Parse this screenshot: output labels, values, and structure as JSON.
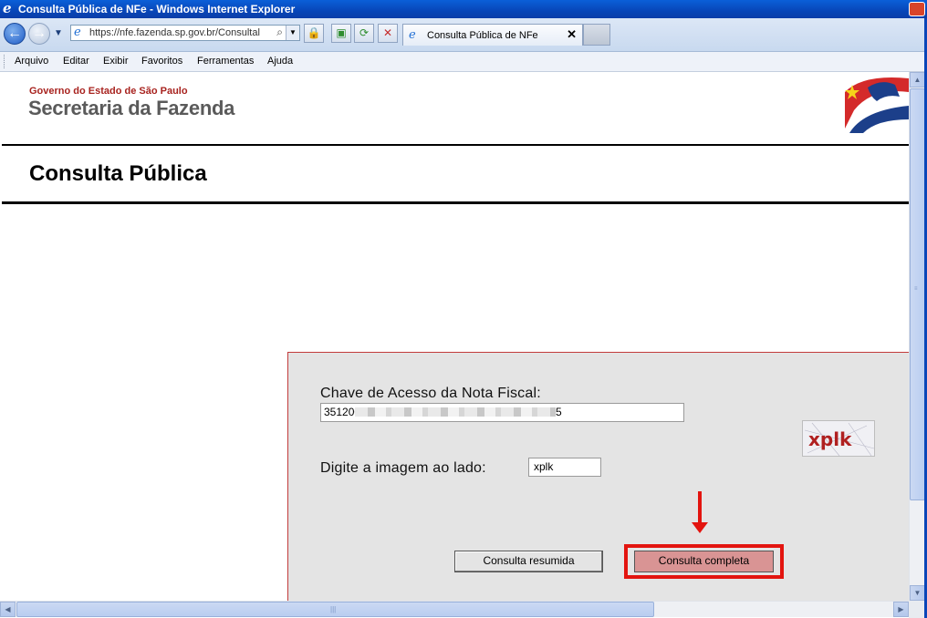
{
  "window": {
    "title": "Consulta Pública de NFe - Windows Internet Explorer"
  },
  "navbar": {
    "url": "https://nfe.fazenda.sp.gov.br/Consultal",
    "tab_label": "Consulta Pública de NFe"
  },
  "menu": [
    "Arquivo",
    "Editar",
    "Exibir",
    "Favoritos",
    "Ferramentas",
    "Ajuda"
  ],
  "header": {
    "government": "Governo do Estado de São Paulo",
    "secretariat": "Secretaria da Fazenda",
    "page_title": "Consulta Pública"
  },
  "form": {
    "chave_label": "Chave de Acesso da Nota Fiscal:",
    "chave_value_start": "351200",
    "chave_value_end": "5",
    "image_label": "Digite a imagem ao lado:",
    "image_value": "xplk",
    "captcha_text": "xplk",
    "button_resumida": "Consulta resumida",
    "button_completa": "Consulta completa"
  },
  "colors": {
    "highlight": "#e3140f",
    "brand_red": "#a8231f",
    "panel_bg": "#e4e4e4"
  }
}
